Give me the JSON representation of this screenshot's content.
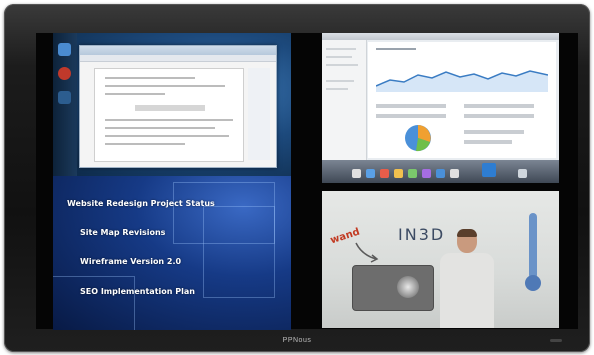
{
  "monitor": {
    "brand": "PPNous"
  },
  "slide": {
    "title": "Website Redesign Project Status",
    "items": [
      "Site Map Revisions",
      "Wireframe Version 2.0",
      "SEO Implementation Plan"
    ]
  },
  "presenter_board": {
    "wand_label": "wand",
    "board_text": "IN3D"
  },
  "colors": {
    "bezel": "#1a1a1a",
    "slide_background": "#163a86",
    "desktop_background": "#1d4a7d",
    "whiteboard": "#d9dcda"
  }
}
